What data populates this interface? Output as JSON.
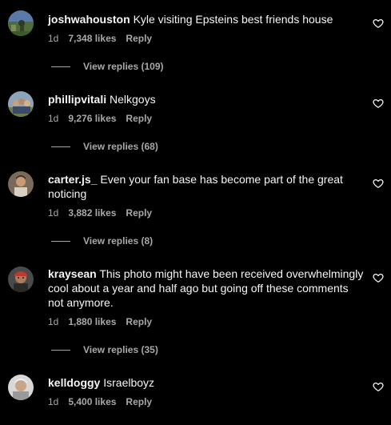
{
  "comments": [
    {
      "username": "joshwahouston",
      "text": "Kyle visiting Epsteins best friends house",
      "time": "1d",
      "likes": "7,348 likes",
      "reply": "Reply",
      "view_replies": "View replies (109)",
      "avatar": "avatar-landscape"
    },
    {
      "username": "phillipvitali",
      "text": "Nelkgoys",
      "time": "1d",
      "likes": "9,276 likes",
      "reply": "Reply",
      "view_replies": "View replies (68)",
      "avatar": "avatar-group"
    },
    {
      "username": "carter.js_",
      "text": "Even your fan base has become part of the great noticing",
      "time": "1d",
      "likes": "3,882 likes",
      "reply": "Reply",
      "view_replies": "View replies (8)",
      "avatar": "avatar-person"
    },
    {
      "username": "kraysean",
      "text": "This photo might have been received overwhelmingly cool about a year and half ago but going off these comments not anymore.",
      "time": "1d",
      "likes": "1,880 likes",
      "reply": "Reply",
      "view_replies": "View replies (35)",
      "avatar": "avatar-person-red"
    },
    {
      "username": "kelldoggy",
      "text": "Israelboyz",
      "time": "1d",
      "likes": "5,400 likes",
      "reply": "Reply",
      "avatar": "avatar-person-white"
    }
  ],
  "colors": {
    "background": "#000000",
    "primary_text": "#f5f5f5",
    "secondary_text": "#a8a8a8"
  },
  "icons": {
    "like": "heart-outline-icon"
  }
}
